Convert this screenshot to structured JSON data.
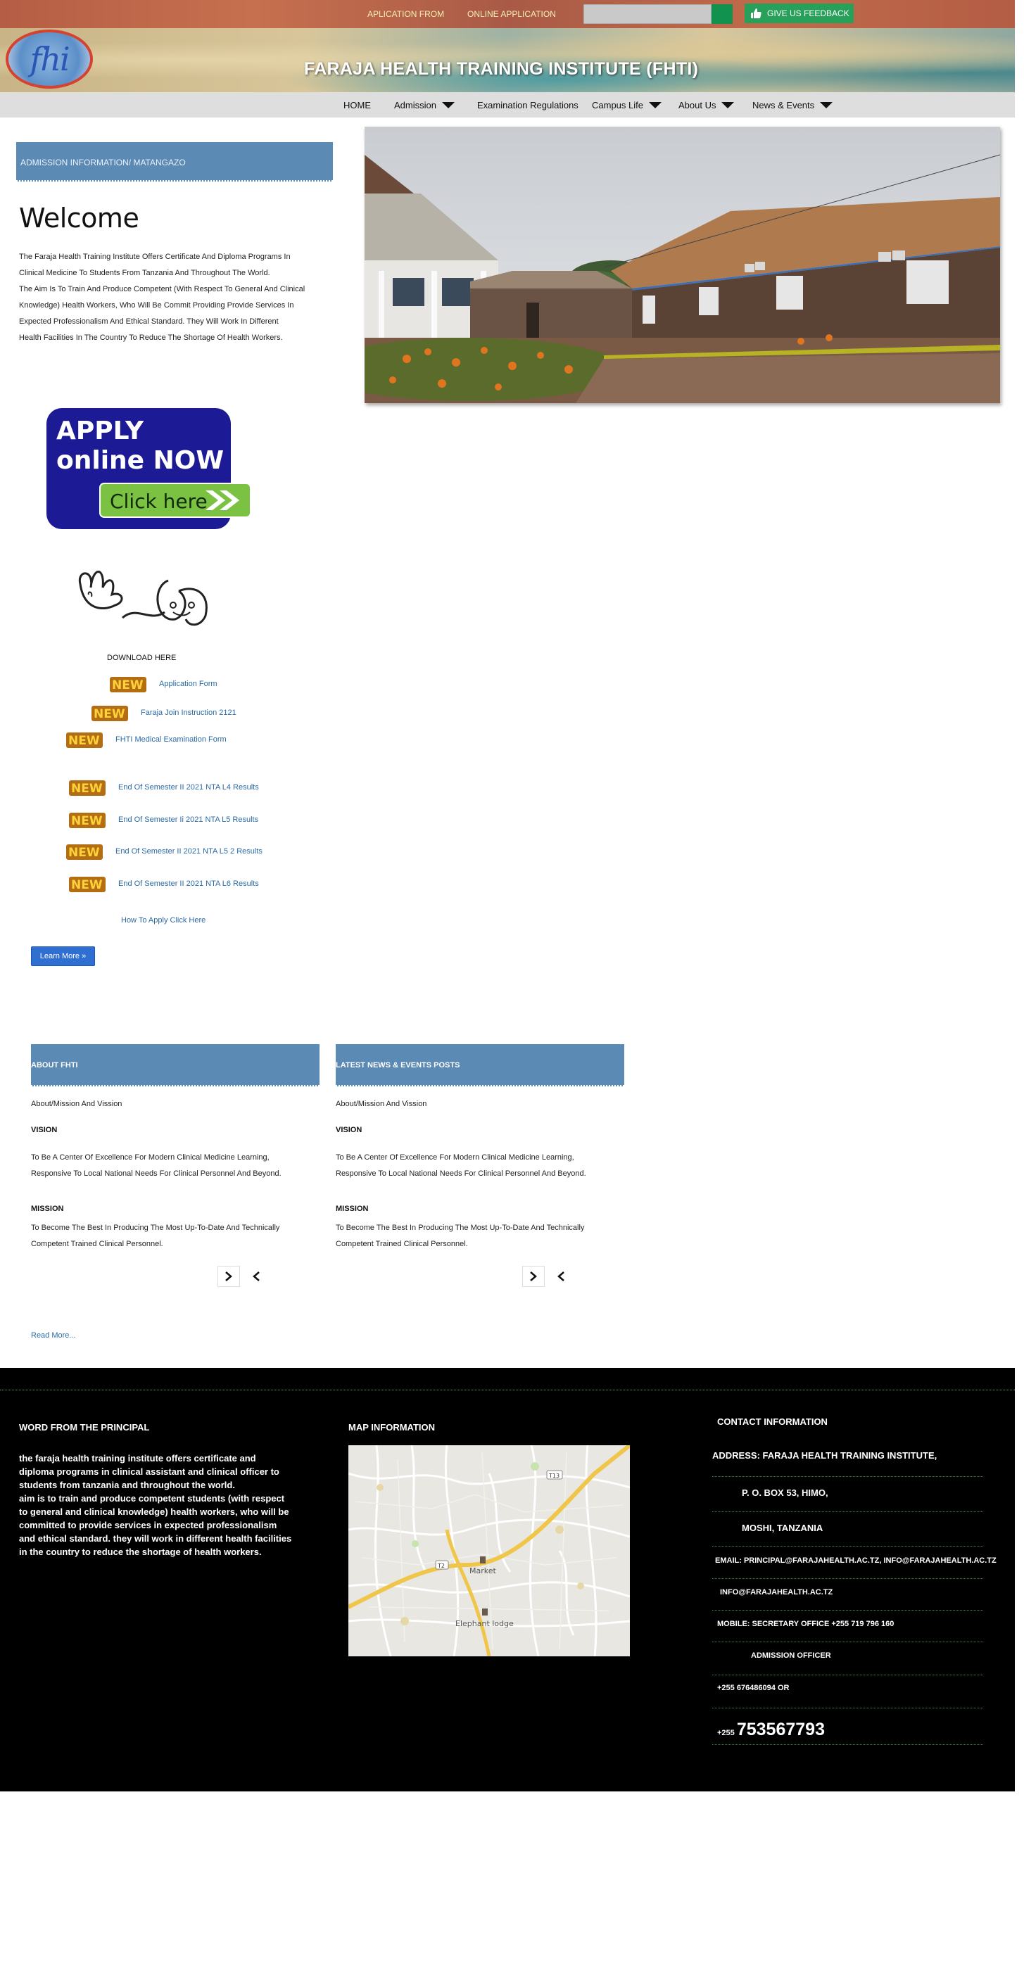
{
  "top_nav": {
    "application_form": "APLICATION FROM",
    "online_application": "ONLINE APPLICATION",
    "search_placeholder": "",
    "feedback": "GIVE US FEEDBACK"
  },
  "header": {
    "logo_text": "fhi",
    "title": "FARAJA HEALTH TRAINING INSTITUTE (FHTI)"
  },
  "main_nav": {
    "home": "HOME",
    "admission": "Admission",
    "exam_regulations": "Examination Regulations",
    "campus_life": "Campus Life",
    "about_us": "About Us",
    "news_events": "News & Events"
  },
  "intro": {
    "admission_bar": "ADMISSION INFORMATION/ MATANGAZO",
    "welcome": "Welcome",
    "lines": [
      "The Faraja Health Training Institute Offers Certificate And Diploma Programs In",
      " Clinical Medicine To Students From Tanzania And Throughout The World.",
      "The Aim Is To Train And Produce Competent (With Respect To General And Clinical",
      " Knowledge) Health Workers, Who Will Be Commit Providing Provide Services In",
      "Expected Professionalism And Ethical Standard. They Will Work In Different",
      " Health Facilities In The Country To Reduce The Shortage Of Health Workers."
    ]
  },
  "apply_banner": {
    "line1": "APPLY",
    "line2": "online NOW",
    "button": "Click here"
  },
  "downloads": {
    "label": "DOWNLOAD HERE",
    "badge": "NEW",
    "items": [
      "Application Form",
      "Faraja Join Instruction 2121",
      "FHTI Medical Examination Form",
      "End Of Semester II 2021 NTA L4 Results",
      "End Of Semester Ii 2021 NTA L5 Results",
      "End Of Semester II 2021 NTA L5 2 Results",
      "End Of Semester II 2021 NTA L6 Results"
    ],
    "how_to_apply": "How To Apply Click Here",
    "learn_more": "Learn More »"
  },
  "panels": {
    "about": {
      "title": "ABOUT FHTI",
      "subtitle": "About/Mission And Vission",
      "vision_head": "VISION",
      "vision_1": "To Be A Center Of Excellence For Modern Clinical Medicine Learning,",
      "vision_2": "Responsive To Local National Needs For Clinical Personnel And Beyond.",
      "mission_head": "MISSION",
      "mission_1": "To Become The Best In Producing The Most Up-To-Date And Technically",
      "mission_2": "Competent Trained Clinical Personnel."
    },
    "news": {
      "title": "LATEST NEWS  & EVENTS POSTS",
      "subtitle": "About/Mission And Vission",
      "vision_head": "VISION",
      "vision_1": "To Be A Center Of Excellence For Modern Clinical Medicine Learning,",
      "vision_2": "Responsive To Local National Needs For Clinical Personnel And Beyond.",
      "mission_head": "MISSION",
      "mission_1": "To Become The Best In Producing The Most Up-To-Date And Technically",
      "mission_2": "Competent Trained Clinical Personnel."
    },
    "read_more": "Read More..."
  },
  "footer": {
    "principal_head": "WORD FROM THE PRINCIPAL",
    "principal_lines": [
      "the faraja health training institute offers certificate and",
      "diploma programs in clinical assistant and clinical officer to",
      "students from tanzania and throughout the world.",
      " aim is to train and produce competent students (with respect",
      "to general and clinical knowledge) health workers, who will be",
      "committed to provide services in expected professionalism",
      "and ethical standard. they will work in different health facilities",
      "in the country to reduce the shortage of health workers."
    ],
    "map_head": "MAP INFORMATION",
    "map_labels": {
      "market": "Market",
      "lodge": "Elephant lodge",
      "road_t13": "T13",
      "road_t2": "T2"
    },
    "contact_head": "CONTACT INFORMATION",
    "address": "ADDRESS:  FARAJA HEALTH TRAINING INSTITUTE,",
    "po_box": "P. O. BOX 53, HIMO,",
    "city": "MOSHI, TANZANIA",
    "email": "EMAIL:  PRINCIPAL@FARAJAHEALTH.AC.TZ, INFO@FARAJAHEALTH.AC.TZ",
    "email2": "INFO@FARAJAHEALTH.AC.TZ",
    "mobile": "MOBILE:  SECRETARY OFFICE +255 719 796 160",
    "admission_officer": "ADMISSION OFFICER",
    "phone1": "+255 676486094 OR",
    "phone2_prefix": "+255",
    "phone2": "753567793"
  },
  "colors": {
    "panel_blue": "#5b8ab5",
    "link_blue": "#2a6aa5",
    "feedback_green": "#27a05a",
    "footer_bg": "#000000"
  }
}
